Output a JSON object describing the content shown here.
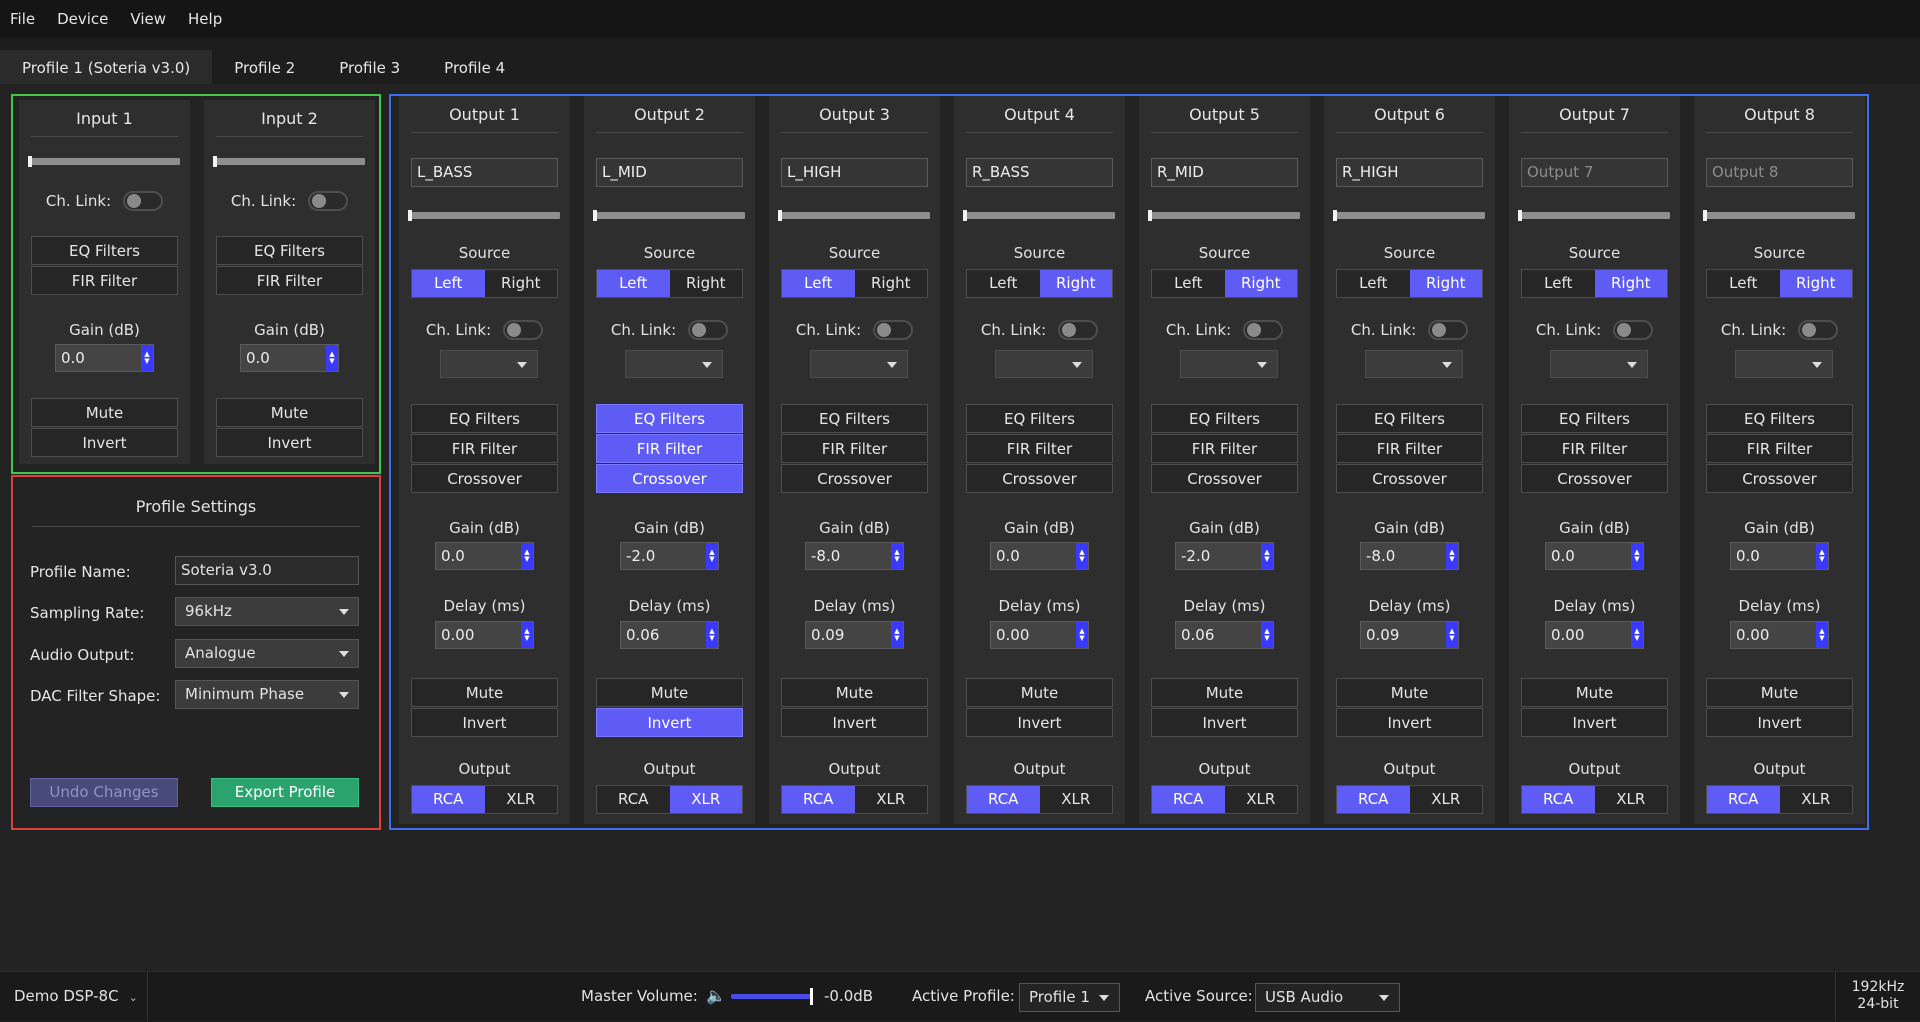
{
  "menu": [
    "File",
    "Device",
    "View",
    "Help"
  ],
  "tabs": [
    "Profile 1 (Soteria v3.0)",
    "Profile 2",
    "Profile 3",
    "Profile 4"
  ],
  "common": {
    "ch_link": "Ch. Link:",
    "eq": "EQ Filters",
    "fir": "FIR Filter",
    "crossover": "Crossover",
    "gain": "Gain (dB)",
    "delay": "Delay (ms)",
    "mute": "Mute",
    "invert": "Invert",
    "source": "Source",
    "left": "Left",
    "right": "Right",
    "output": "Output",
    "rca": "RCA",
    "xlr": "XLR"
  },
  "inputs": [
    {
      "name": "Input 1",
      "gain": "0.0"
    },
    {
      "name": "Input 2",
      "gain": "0.0"
    }
  ],
  "outputs": [
    {
      "name": "Output 1",
      "label": "L_BASS",
      "placeholder": "",
      "source": "Left",
      "gain": "0.0",
      "delay": "0.00",
      "eq": false,
      "fir": false,
      "crossover": false,
      "mute": false,
      "invert": false,
      "out": "RCA"
    },
    {
      "name": "Output 2",
      "label": "L_MID",
      "placeholder": "",
      "source": "Left",
      "gain": "-2.0",
      "delay": "0.06",
      "eq": true,
      "fir": true,
      "crossover": true,
      "mute": false,
      "invert": true,
      "out": "XLR"
    },
    {
      "name": "Output 3",
      "label": "L_HIGH",
      "placeholder": "",
      "source": "Left",
      "gain": "-8.0",
      "delay": "0.09",
      "eq": false,
      "fir": false,
      "crossover": false,
      "mute": false,
      "invert": false,
      "out": "RCA"
    },
    {
      "name": "Output 4",
      "label": "R_BASS",
      "placeholder": "",
      "source": "Right",
      "gain": "0.0",
      "delay": "0.00",
      "eq": false,
      "fir": false,
      "crossover": false,
      "mute": false,
      "invert": false,
      "out": "RCA"
    },
    {
      "name": "Output 5",
      "label": "R_MID",
      "placeholder": "",
      "source": "Right",
      "gain": "-2.0",
      "delay": "0.06",
      "eq": false,
      "fir": false,
      "crossover": false,
      "mute": false,
      "invert": false,
      "out": "RCA"
    },
    {
      "name": "Output 6",
      "label": "R_HIGH",
      "placeholder": "",
      "source": "Right",
      "gain": "-8.0",
      "delay": "0.09",
      "eq": false,
      "fir": false,
      "crossover": false,
      "mute": false,
      "invert": false,
      "out": "RCA"
    },
    {
      "name": "Output 7",
      "label": "",
      "placeholder": "Output 7",
      "source": "Right",
      "gain": "0.0",
      "delay": "0.00",
      "eq": false,
      "fir": false,
      "crossover": false,
      "mute": false,
      "invert": false,
      "out": "RCA"
    },
    {
      "name": "Output 8",
      "label": "",
      "placeholder": "Output 8",
      "source": "Right",
      "gain": "0.0",
      "delay": "0.00",
      "eq": false,
      "fir": false,
      "crossover": false,
      "mute": false,
      "invert": false,
      "out": "RCA"
    }
  ],
  "profile_settings": {
    "title": "Profile Settings",
    "name_label": "Profile Name:",
    "name_value": "Soteria v3.0",
    "rate_label": "Sampling Rate:",
    "rate_value": "96kHz",
    "audio_label": "Audio Output:",
    "audio_value": "Analogue",
    "dac_label": "DAC Filter Shape:",
    "dac_value": "Minimum Phase",
    "undo": "Undo Changes",
    "export": "Export Profile"
  },
  "status": {
    "device": "Demo DSP-8C",
    "master_label": "Master Volume:",
    "master_value": "-0.0dB",
    "master_level": 1.0,
    "active_profile_label": "Active Profile:",
    "active_profile": "Profile 1",
    "active_source_label": "Active Source:",
    "active_source": "USB Audio",
    "rate": "192kHz",
    "bits": "24-bit"
  },
  "colors": {
    "accent": "#5e5cf5",
    "input_group": "#43c74a",
    "output_group": "#3d6ef0",
    "settings_group": "#e0403a",
    "export": "#2aa46c"
  },
  "icons": {
    "speaker": "speaker-icon",
    "dropdown": "chevron-down-icon",
    "spin": "spin-arrows-icon"
  }
}
